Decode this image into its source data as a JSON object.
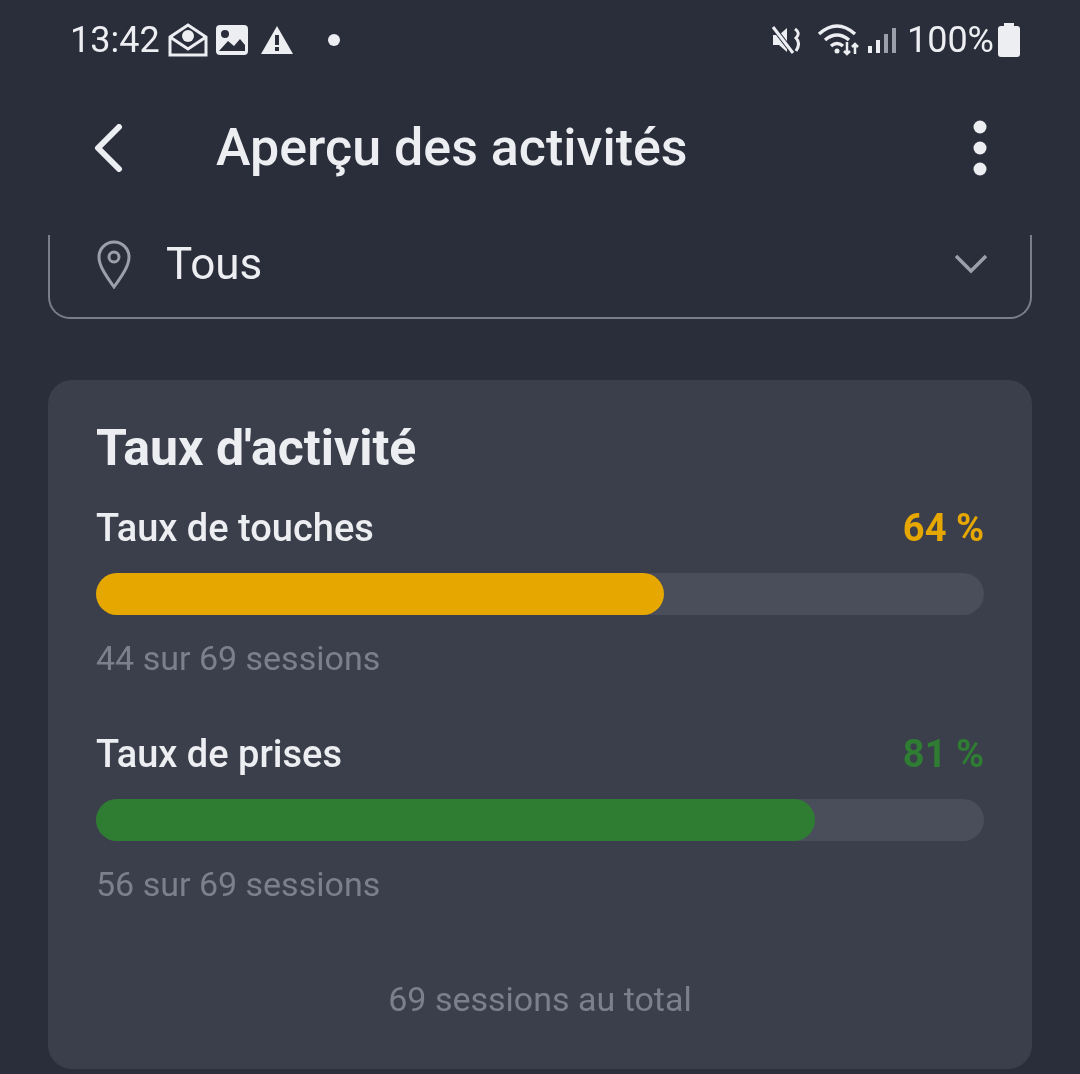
{
  "status_bar": {
    "time": "13:42",
    "battery": "100%"
  },
  "app_bar": {
    "title": "Aperçu des activités"
  },
  "location_filter": {
    "value": "Tous"
  },
  "card": {
    "title": "Taux d'activité",
    "metrics": [
      {
        "label": "Taux de touches",
        "value": "64 %",
        "level": 0.64,
        "color": "#e6a800",
        "detail": "44 sur 69 sessions"
      },
      {
        "label": "Taux de prises",
        "value": "81 %",
        "level": 0.81,
        "color": "#2e7d32",
        "detail": "56 sur 69 sessions"
      }
    ],
    "footer": "69 sessions au total"
  }
}
